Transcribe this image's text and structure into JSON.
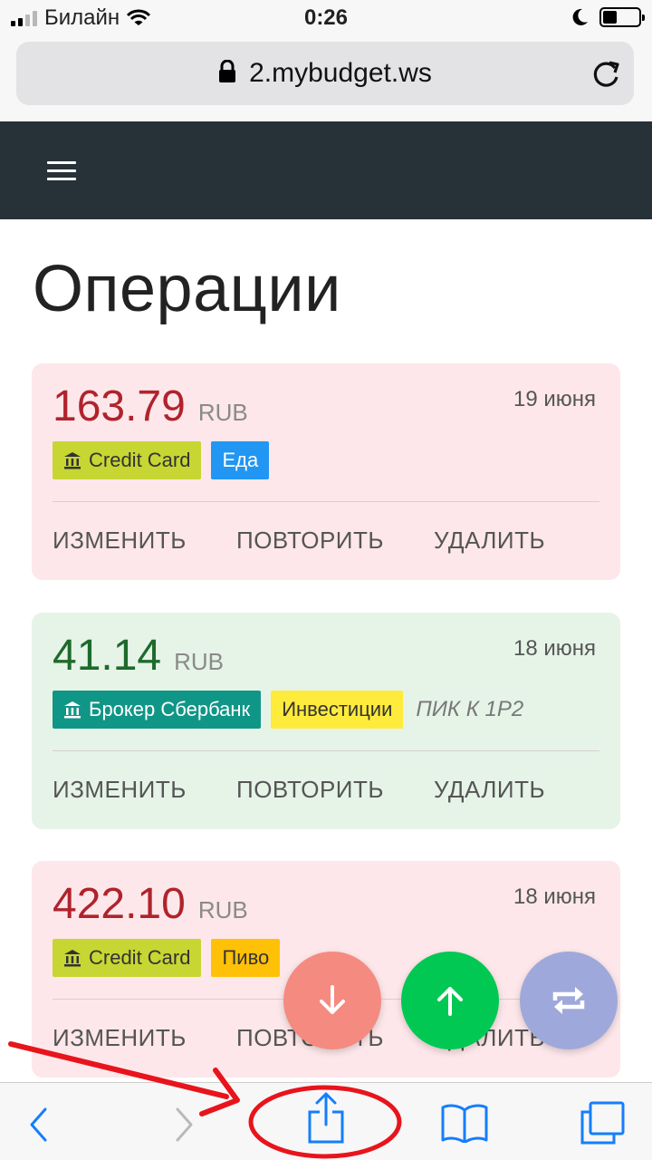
{
  "status_bar": {
    "carrier": "Билайн",
    "time": "0:26"
  },
  "browser": {
    "url": "2.mybudget.ws"
  },
  "page": {
    "title": "Операции"
  },
  "operations": [
    {
      "amount": "163.79",
      "currency": "RUB",
      "date": "19 июня",
      "type": "expense",
      "account": "Credit Card",
      "category": "Еда",
      "note": "",
      "actions": {
        "edit": "ИЗМЕНИТЬ",
        "repeat": "ПОВТОРИТЬ",
        "delete": "УДАЛИТЬ"
      }
    },
    {
      "amount": "41.14",
      "currency": "RUB",
      "date": "18 июня",
      "type": "income",
      "account": "Брокер Сбербанк",
      "category": "Инвестиции",
      "note": "ПИК К 1Р2",
      "actions": {
        "edit": "ИЗМЕНИТЬ",
        "repeat": "ПОВТОРИТЬ",
        "delete": "УДАЛИТЬ"
      }
    },
    {
      "amount": "422.10",
      "currency": "RUB",
      "date": "18 июня",
      "type": "expense",
      "account": "Credit Card",
      "category": "Пиво",
      "note": "",
      "actions": {
        "edit": "ИЗМЕНИТЬ",
        "repeat": "ПОВТОРИТЬ",
        "delete": "УДАЛИТЬ"
      }
    }
  ],
  "fab_buttons": [
    {
      "icon": "arrow-down-icon",
      "color": "#f58a80"
    },
    {
      "icon": "arrow-up-icon",
      "color": "#00c853"
    },
    {
      "icon": "transfer-icon",
      "color": "#9fa8da"
    }
  ],
  "toolbar_icons": [
    "back-icon",
    "forward-icon",
    "share-icon",
    "bookmarks-icon",
    "tabs-icon"
  ],
  "colors": {
    "navbar": "#263238",
    "expense_card": "#fde7ea",
    "income_card": "#e6f4e8",
    "annotation": "#e8141c",
    "ios_blue": "#157efb"
  }
}
